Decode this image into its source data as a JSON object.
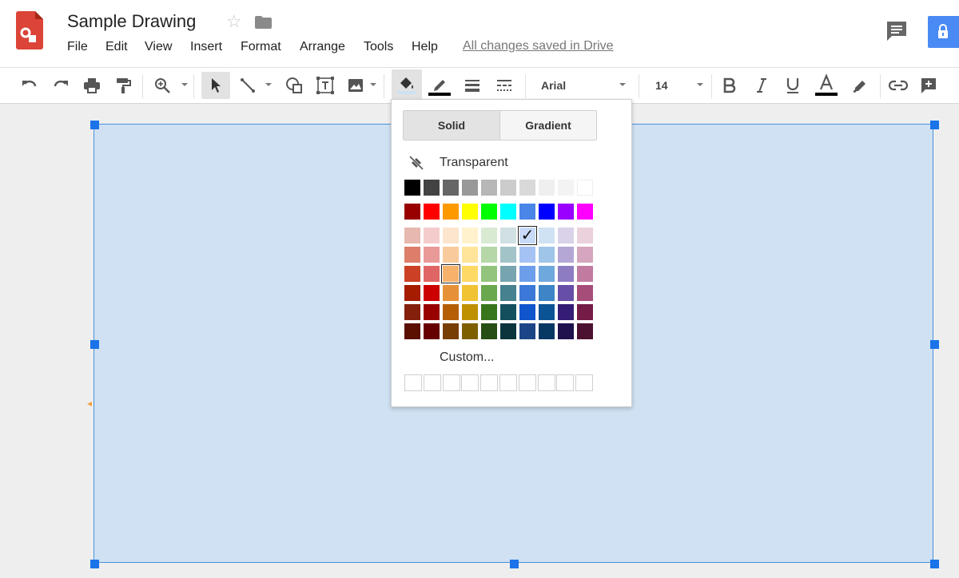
{
  "header": {
    "title": "Sample Drawing",
    "save_status": "All changes saved in Drive",
    "menu": [
      "File",
      "Edit",
      "View",
      "Insert",
      "Format",
      "Arrange",
      "Tools",
      "Help"
    ]
  },
  "toolbar": {
    "font": "Arial",
    "font_size": "14",
    "icons": [
      "undo-icon",
      "redo-icon",
      "print-icon",
      "paint-format-icon",
      "zoom-icon",
      "select-icon",
      "line-icon",
      "shape-icon",
      "textbox-icon",
      "image-icon",
      "fill-color-icon",
      "border-color-icon",
      "border-weight-icon",
      "border-dash-icon",
      "bold-icon",
      "italic-icon",
      "underline-icon",
      "text-color-icon",
      "highlight-icon",
      "link-icon",
      "comment-add-icon"
    ]
  },
  "fill_popup": {
    "tabs": [
      "Solid",
      "Gradient"
    ],
    "active_tab": "Solid",
    "transparent_label": "Transparent",
    "custom_label": "Custom...",
    "check_mark": "✓",
    "selected_color": "#c9daf8",
    "hover_color": "#f6b26b"
  },
  "colors": {
    "shape_fill": "#cfe1f3",
    "shape_border": "#4a90d9",
    "share_button": "#4a8af4",
    "logo": "#db4437"
  },
  "palette": {
    "grays": [
      "#000000",
      "#434343",
      "#666666",
      "#999999",
      "#b7b7b7",
      "#cccccc",
      "#d9d9d9",
      "#efefef",
      "#f3f3f3",
      "#ffffff"
    ],
    "bright": [
      "#980000",
      "#ff0000",
      "#ff9900",
      "#ffff00",
      "#00ff00",
      "#00ffff",
      "#4a86e8",
      "#0000ff",
      "#9900ff",
      "#ff00ff"
    ],
    "shades": [
      [
        "#e6b8af",
        "#f4cccc",
        "#fce5cd",
        "#fff2cc",
        "#d9ead3",
        "#d0e0e3",
        "#c9daf8",
        "#cfe2f3",
        "#d9d2e9",
        "#ead1dc"
      ],
      [
        "#dd7e6b",
        "#ea9999",
        "#f9cb9c",
        "#ffe599",
        "#b6d7a8",
        "#a2c4c9",
        "#a4c2f4",
        "#9fc5e8",
        "#b4a7d6",
        "#d5a6bd"
      ],
      [
        "#cc4125",
        "#e06666",
        "#f6b26b",
        "#ffd966",
        "#93c47d",
        "#76a5af",
        "#6d9eeb",
        "#6fa8dc",
        "#8e7cc3",
        "#c27ba0"
      ],
      [
        "#a61c00",
        "#cc0000",
        "#e69138",
        "#f1c232",
        "#6aa84f",
        "#45818e",
        "#3c78d8",
        "#3d85c6",
        "#674ea7",
        "#a64d79"
      ],
      [
        "#85200c",
        "#990000",
        "#b45f06",
        "#bf9000",
        "#38761d",
        "#134f5c",
        "#1155cc",
        "#0b5394",
        "#351c75",
        "#741b47"
      ],
      [
        "#5b0f00",
        "#660000",
        "#783f04",
        "#7f6000",
        "#274e13",
        "#0c343d",
        "#1c4587",
        "#073763",
        "#20124d",
        "#4c1130"
      ]
    ]
  }
}
